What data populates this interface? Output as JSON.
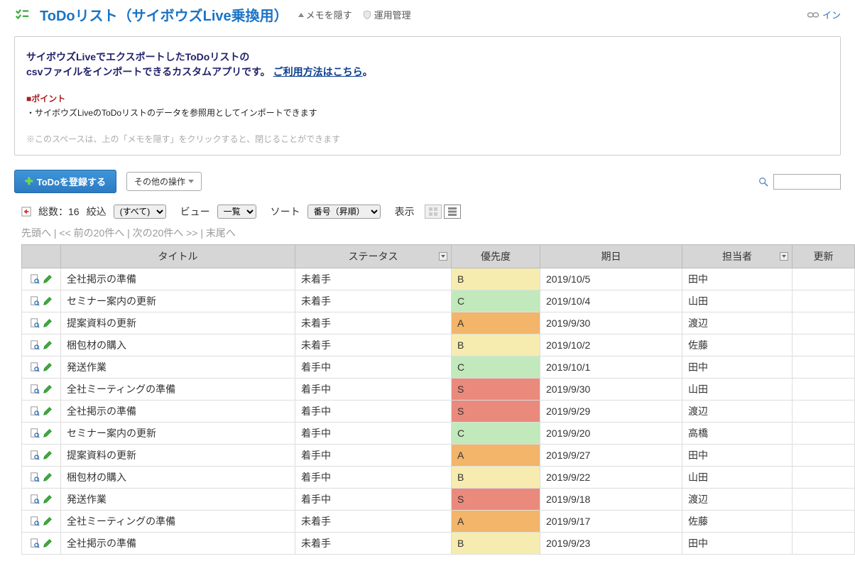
{
  "header": {
    "title": "ToDoリスト（サイボウズLive乗換用）",
    "hideMemo": "メモを隠す",
    "admin": "運用管理",
    "linkRight": "イン"
  },
  "memo": {
    "line1": "サイボウズLiveでエクスポートしたToDoリストの",
    "line2a": "csvファイルをインポートできるカスタムアプリです。",
    "line2link": "ご利用方法はこちら",
    "line2end": "。",
    "pointHeading": "■ポイント",
    "pointItem": "・サイボウズLiveのToDoリストのデータを参照用としてインポートできます",
    "hint": "※このスペースは、上の「メモを隠す」をクリックすると、閉じることができます"
  },
  "toolbar": {
    "registerLabel": "ToDoを登録する",
    "otherOpsLabel": "その他の操作"
  },
  "controls": {
    "totalLabel": "総数：",
    "total": "16",
    "filterLabel": "絞込",
    "filterValue": "(すべて)",
    "viewLabel": "ビュー",
    "viewValue": "一覧",
    "sortLabel": "ソート",
    "sortValue": "番号（昇順）",
    "displayLabel": "表示"
  },
  "pager": {
    "first": "先頭へ",
    "prev": "<< 前の20件へ",
    "next": "次の20件へ >>",
    "last": "末尾へ"
  },
  "table": {
    "headers": {
      "title": "タイトル",
      "status": "ステータス",
      "priority": "優先度",
      "date": "期日",
      "assignee": "担当者",
      "updated": "更新"
    },
    "rows": [
      {
        "title": "全社掲示の準備",
        "status": "未着手",
        "priority": "B",
        "date": "2019/10/5",
        "assignee": "田中"
      },
      {
        "title": "セミナー案内の更新",
        "status": "未着手",
        "priority": "C",
        "date": "2019/10/4",
        "assignee": "山田"
      },
      {
        "title": "提案資料の更新",
        "status": "未着手",
        "priority": "A",
        "date": "2019/9/30",
        "assignee": "渡辺"
      },
      {
        "title": "梱包材の購入",
        "status": "未着手",
        "priority": "B",
        "date": "2019/10/2",
        "assignee": "佐藤"
      },
      {
        "title": "発送作業",
        "status": "着手中",
        "priority": "C",
        "date": "2019/10/1",
        "assignee": "田中"
      },
      {
        "title": "全社ミーティングの準備",
        "status": "着手中",
        "priority": "S",
        "date": "2019/9/30",
        "assignee": "山田"
      },
      {
        "title": "全社掲示の準備",
        "status": "着手中",
        "priority": "S",
        "date": "2019/9/29",
        "assignee": "渡辺"
      },
      {
        "title": "セミナー案内の更新",
        "status": "着手中",
        "priority": "C",
        "date": "2019/9/20",
        "assignee": "高橋"
      },
      {
        "title": "提案資料の更新",
        "status": "着手中",
        "priority": "A",
        "date": "2019/9/27",
        "assignee": "田中"
      },
      {
        "title": "梱包材の購入",
        "status": "着手中",
        "priority": "B",
        "date": "2019/9/22",
        "assignee": "山田"
      },
      {
        "title": "発送作業",
        "status": "着手中",
        "priority": "S",
        "date": "2019/9/18",
        "assignee": "渡辺"
      },
      {
        "title": "全社ミーティングの準備",
        "status": "未着手",
        "priority": "A",
        "date": "2019/9/17",
        "assignee": "佐藤"
      },
      {
        "title": "全社掲示の準備",
        "status": "未着手",
        "priority": "B",
        "date": "2019/9/23",
        "assignee": "田中"
      }
    ]
  }
}
